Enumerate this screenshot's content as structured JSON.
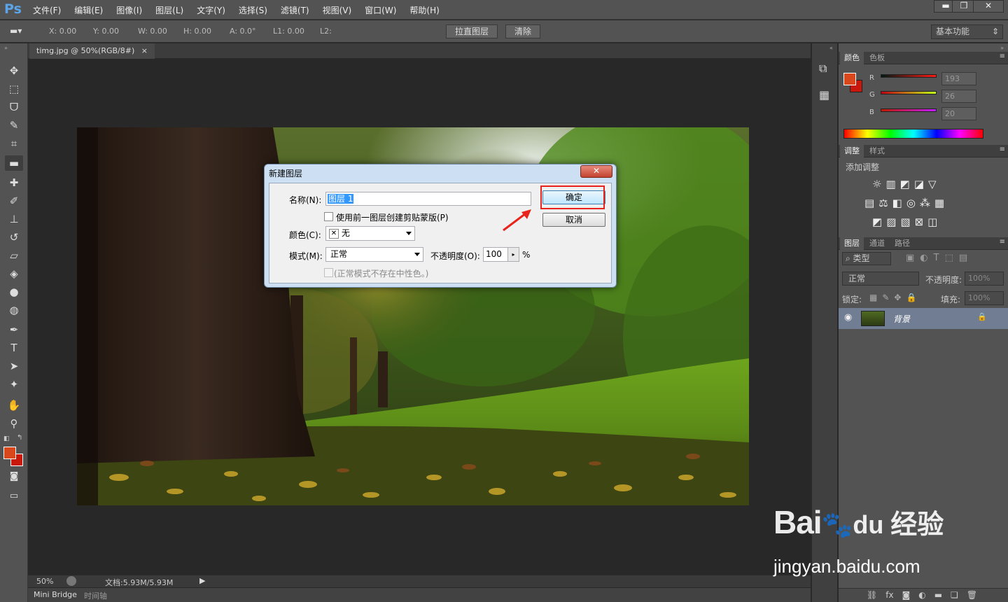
{
  "app": {
    "logo": "Ps"
  },
  "menu": [
    "文件(F)",
    "编辑(E)",
    "图像(I)",
    "图层(L)",
    "文字(Y)",
    "选择(S)",
    "滤镜(T)",
    "视图(V)",
    "窗口(W)",
    "帮助(H)"
  ],
  "window_controls": {
    "min": "▬",
    "restore": "❐",
    "close": "✕"
  },
  "options": {
    "x": "X: 0.00",
    "y": "Y: 0.00",
    "w": "W: 0.00",
    "h": "H: 0.00",
    "a": "A: 0.0°",
    "l1": "L1: 0.00",
    "l2": "L2:",
    "straighten": "拉直图层",
    "clear": "清除",
    "workspace": "基本功能"
  },
  "document": {
    "tab": "timg.jpg @ 50%(RGB/8#)",
    "tab_close": "×"
  },
  "status": {
    "zoom": "50%",
    "doc": "文档:5.93M/5.93M"
  },
  "bottom_tabs": [
    "Mini Bridge",
    "时间轴"
  ],
  "color_panel": {
    "tabs": [
      "颜色",
      "色板"
    ],
    "r_label": "R",
    "g_label": "G",
    "b_label": "B",
    "r": "193",
    "g": "26",
    "b": "20",
    "foreground": "#d9481c",
    "background": "#c8180c"
  },
  "adjust_panel": {
    "tabs": [
      "调整",
      "样式"
    ],
    "heading": "添加调整"
  },
  "layers_panel": {
    "tabs": [
      "图层",
      "通道",
      "路径"
    ],
    "filter": "类型",
    "blend": "正常",
    "opacity_label": "不透明度:",
    "opacity": "100%",
    "lock_label": "锁定:",
    "fill_label": "填充:",
    "fill": "100%",
    "layer_name": "背景"
  },
  "dialog": {
    "title": "新建图层",
    "name_label": "名称(N):",
    "name_value": "图层 1",
    "clip_label": "使用前一图层创建剪贴蒙版(P)",
    "color_label": "颜色(C):",
    "color_value": "无",
    "mode_label": "模式(M):",
    "mode_value": "正常",
    "opacity_label": "不透明度(O):",
    "opacity_value": "100",
    "percent": "%",
    "neutral_label": "(正常模式不存在中性色。)",
    "ok": "确定",
    "cancel": "取消"
  },
  "watermark": {
    "brand": "Bai",
    "brand2": "du",
    "cn": "经验",
    "url": "jingyan.baidu.com"
  }
}
